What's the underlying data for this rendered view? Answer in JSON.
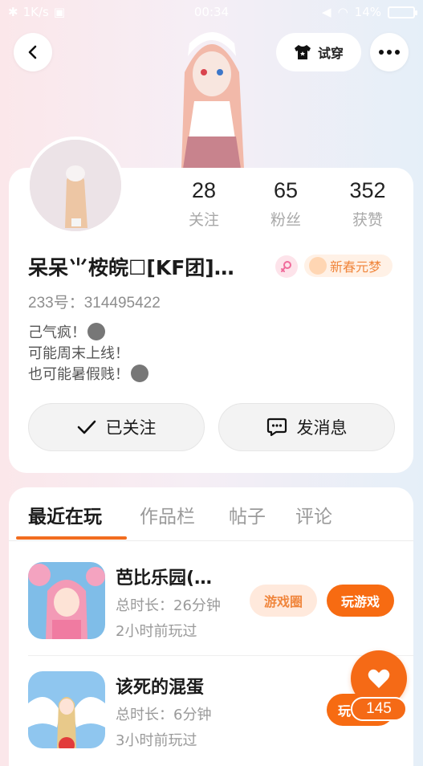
{
  "status_bar": {
    "net_speed": "1K/s",
    "time": "00:34",
    "battery": "14%"
  },
  "header": {
    "try_on_label": "试穿"
  },
  "stats": [
    {
      "value": "28",
      "label": "关注"
    },
    {
      "value": "65",
      "label": "粉丝"
    },
    {
      "value": "352",
      "label": "获赞"
    }
  ],
  "profile": {
    "nickname": "呆呆⺌桉皖☐[KF团]…",
    "badge": "新春元梦",
    "uid": "233号：314495422",
    "bio_lines": [
      "己气疯！",
      "可能周末上线！",
      "也可能暑假贱！"
    ]
  },
  "actions": {
    "follow_label": "已关注",
    "message_label": "发消息"
  },
  "tabs": [
    "最近在玩",
    "作品栏",
    "帖子",
    "评论"
  ],
  "games": [
    {
      "name": "芭比乐园(…",
      "duration": "总时长：26分钟",
      "last_played": "2小时前玩过",
      "circle_label": "游戏圈",
      "play_label": "玩游戏"
    },
    {
      "name": "该死的混蛋",
      "duration": "总时长：6分钟",
      "last_played": "3小时前玩过",
      "play_label": "玩"
    }
  ],
  "like": {
    "count": "145"
  },
  "colors": {
    "accent": "#f56a16",
    "badge_text": "#f0863d"
  }
}
